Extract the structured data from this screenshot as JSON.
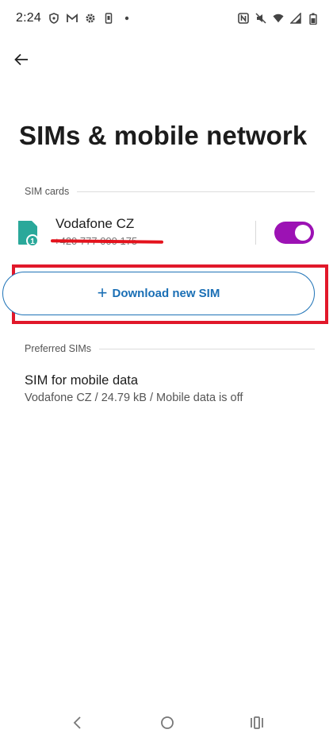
{
  "status_bar": {
    "time": "2:24",
    "left_icons": [
      "shield-icon",
      "gmail-icon",
      "gear-icon",
      "phone-icon",
      "dot-icon"
    ],
    "right_icons": [
      "nfc-icon",
      "mute-icon",
      "wifi-icon",
      "signal-icon",
      "battery-icon"
    ]
  },
  "header": {
    "title": "SIMs & mobile network"
  },
  "sim_cards": {
    "section_label": "SIM cards",
    "sim": {
      "name": "Vodafone CZ",
      "number": "+420 777 000 175",
      "slot": "1",
      "enabled": true
    },
    "download_label": "Download new SIM"
  },
  "preferred": {
    "section_label": "Preferred SIMs",
    "mobile_data": {
      "title": "SIM for mobile data",
      "subtitle": "Vodafone CZ / 24.79 kB / Mobile data is off"
    }
  },
  "colors": {
    "accent": "#1a6fb5",
    "toggle_on": "#9c12b4",
    "highlight": "#e1182a",
    "sim_icon": "#2aa89a"
  }
}
